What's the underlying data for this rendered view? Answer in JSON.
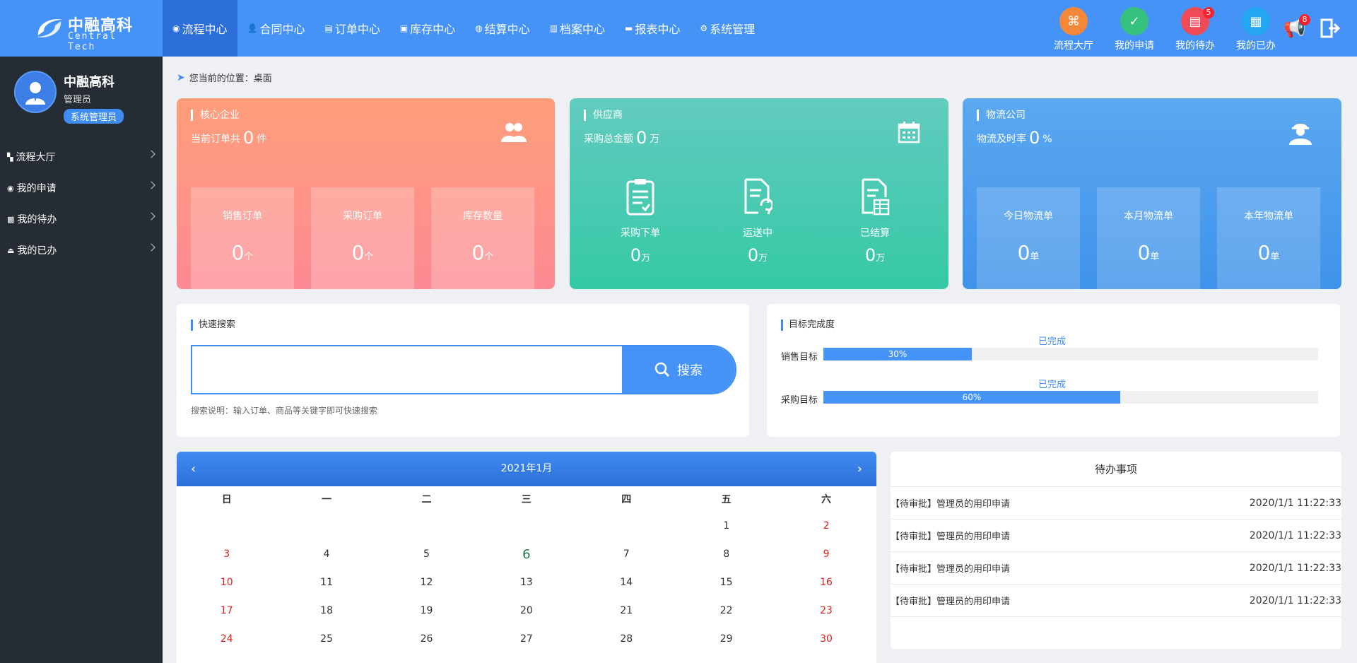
{
  "brand": {
    "name_cn": "中融高科",
    "name_en": "Central Tech"
  },
  "nav": [
    {
      "label": "流程中心",
      "icon": "target-icon",
      "glyph": "◉",
      "active": true
    },
    {
      "label": "合同中心",
      "icon": "user-icon",
      "glyph": "👤"
    },
    {
      "label": "订单中心",
      "icon": "file-icon",
      "glyph": "▤"
    },
    {
      "label": "库存中心",
      "icon": "warehouse-icon",
      "glyph": "▣"
    },
    {
      "label": "结算中心",
      "icon": "money-bag-icon",
      "glyph": "◍"
    },
    {
      "label": "档案中心",
      "icon": "archive-icon",
      "glyph": "▥"
    },
    {
      "label": "报表中心",
      "icon": "report-icon",
      "glyph": "▬"
    },
    {
      "label": "系统管理",
      "icon": "gears-icon",
      "glyph": "⚙"
    }
  ],
  "quick": [
    {
      "label": "流程大厅",
      "icon": "flow-hall-icon",
      "color": "#f5873a",
      "badge": ""
    },
    {
      "label": "我的申请",
      "icon": "clipboard-check-icon",
      "color": "#36c27e",
      "badge": ""
    },
    {
      "label": "我的待办",
      "icon": "pending-doc-icon",
      "color": "#f04a56",
      "badge": "5"
    },
    {
      "label": "我的已办",
      "icon": "done-doc-icon",
      "color": "#23a7f0",
      "badge": ""
    }
  ],
  "header": {
    "notice_badge": "8"
  },
  "user": {
    "name": "中融高科",
    "role": "管理员",
    "tag": "系统管理员"
  },
  "sidebar": [
    {
      "label": "流程大厅",
      "icon": "flow-icon",
      "glyph": "▚"
    },
    {
      "label": "我的申请",
      "icon": "eye-icon",
      "glyph": "◉"
    },
    {
      "label": "我的待办",
      "icon": "inbox-icon",
      "glyph": "▩"
    },
    {
      "label": "我的已办",
      "icon": "stamp-icon",
      "glyph": "⏏"
    }
  ],
  "breadcrumb": {
    "prefix": "您当前的位置：",
    "current": "桌面"
  },
  "core": {
    "title": "核心企业",
    "sub_pre": "当前订单共",
    "sub_val": "0",
    "sub_unit": "件",
    "stats": [
      {
        "label": "销售订单",
        "value": "0",
        "unit": "个"
      },
      {
        "label": "采购订单",
        "value": "0",
        "unit": "个"
      },
      {
        "label": "库存数量",
        "value": "0",
        "unit": "个"
      }
    ]
  },
  "supplier": {
    "title": "供应商",
    "sub_pre": "采购总金额",
    "sub_val": "0",
    "sub_unit": "万",
    "stats": [
      {
        "label": "采购下单",
        "value": "0",
        "unit": "万"
      },
      {
        "label": "运送中",
        "value": "0",
        "unit": "万"
      },
      {
        "label": "已结算",
        "value": "0",
        "unit": "万"
      }
    ]
  },
  "logistics": {
    "title": "物流公司",
    "sub_pre": "物流及时率",
    "sub_val": "0",
    "sub_unit": "%",
    "stats": [
      {
        "label": "今日物流单",
        "value": "0",
        "unit": "单"
      },
      {
        "label": "本月物流单",
        "value": "0",
        "unit": "单"
      },
      {
        "label": "本年物流单",
        "value": "0",
        "unit": "单"
      }
    ]
  },
  "search": {
    "title": "快速搜索",
    "placeholder": "",
    "button": "搜索",
    "hint": "搜索说明：输入订单、商品等关键字即可快速搜索"
  },
  "goals": {
    "title": "目标完成度",
    "items": [
      {
        "label": "销售目标",
        "done_label": "已完成",
        "percent": 30,
        "percent_text": "30%"
      },
      {
        "label": "采购目标",
        "done_label": "已完成",
        "percent": 60,
        "percent_text": "60%"
      }
    ]
  },
  "calendar": {
    "title": "2021年1月",
    "weekdays": [
      "日",
      "一",
      "二",
      "三",
      "四",
      "五",
      "六"
    ],
    "weeks": [
      [
        "",
        "",
        "",
        "",
        "",
        "1",
        "2"
      ],
      [
        "3",
        "4",
        "5",
        "6",
        "7",
        "8",
        "9"
      ],
      [
        "10",
        "11",
        "12",
        "13",
        "14",
        "15",
        "16"
      ],
      [
        "17",
        "18",
        "19",
        "20",
        "21",
        "22",
        "23"
      ],
      [
        "24",
        "25",
        "26",
        "27",
        "28",
        "29",
        "30"
      ]
    ],
    "today": "6"
  },
  "todo": {
    "title": "待办事项",
    "items": [
      {
        "text": "【待审批】管理员的用印申请",
        "time": "2020/1/1 11:22:33"
      },
      {
        "text": "【待审批】管理员的用印申请",
        "time": "2020/1/1 11:22:33"
      },
      {
        "text": "【待审批】管理员的用印申请",
        "time": "2020/1/1 11:22:33"
      },
      {
        "text": "【待审批】管理员的用印申请",
        "time": "2020/1/1 11:22:33"
      }
    ]
  }
}
